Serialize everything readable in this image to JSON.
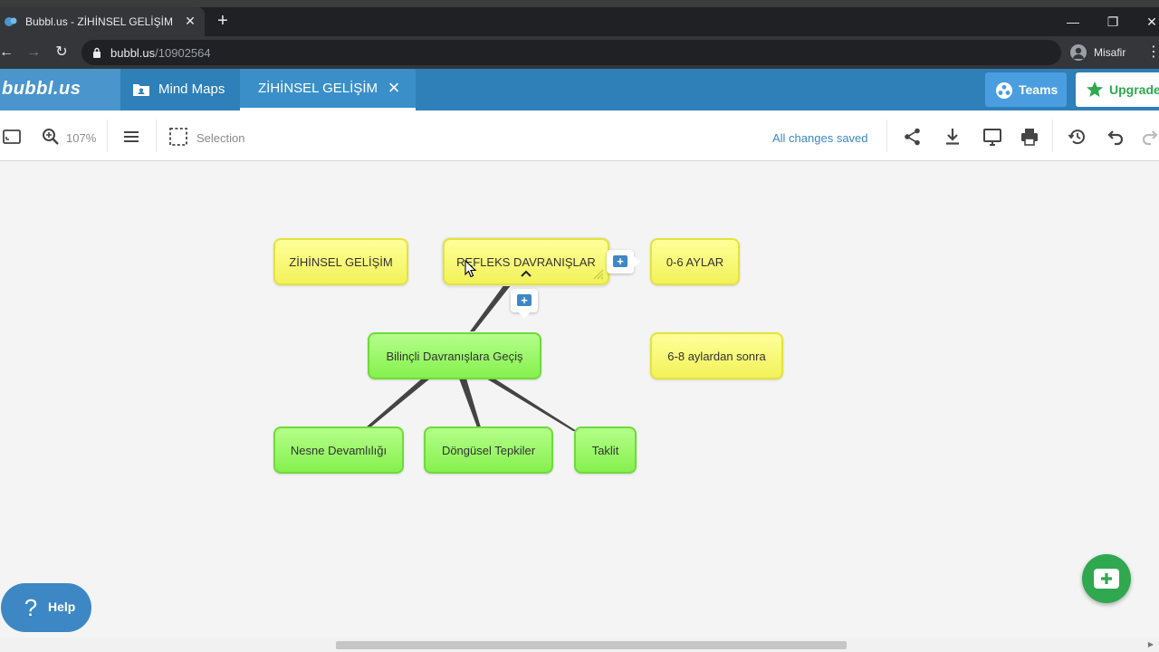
{
  "browser": {
    "tab_title": "Bubbl.us - ZİHİNSEL GELİŞİM",
    "url_host": "bubbl.us",
    "url_path": "/10902564",
    "profile_name": "Misafir"
  },
  "header": {
    "logo": "bubbl.us",
    "nav_mindmaps": "Mind Maps",
    "doc_tab": "ZİHİNSEL GELİŞİM",
    "teams_label": "Teams",
    "upgrade_label": "Upgrade"
  },
  "toolbar": {
    "zoom": "107%",
    "selection_label": "Selection",
    "save_status": "All changes saved"
  },
  "mindmap": {
    "nodes": [
      {
        "id": "n1",
        "label": "ZİHİNSEL GELİŞİM",
        "color": "yellow"
      },
      {
        "id": "n2",
        "label": "REFLEKS DAVRANIŞLAR",
        "color": "yellow",
        "selected": true
      },
      {
        "id": "n3",
        "label": "0-6 AYLAR",
        "color": "yellow"
      },
      {
        "id": "n4",
        "label": "Bilinçli Davranışlara Geçiş",
        "color": "green"
      },
      {
        "id": "n5",
        "label": "6-8 aylardan sonra",
        "color": "yellow"
      },
      {
        "id": "n6",
        "label": "Nesne Devamlılığı",
        "color": "green"
      },
      {
        "id": "n7",
        "label": "Döngüsel Tepkiler",
        "color": "green"
      },
      {
        "id": "n8",
        "label": "Taklit",
        "color": "green"
      }
    ],
    "connections": [
      [
        "n2",
        "n4"
      ],
      [
        "n4",
        "n6"
      ],
      [
        "n4",
        "n7"
      ],
      [
        "n4",
        "n8"
      ]
    ]
  },
  "help": {
    "label": "Help"
  },
  "colors": {
    "header_blue": "#2f7fb8",
    "accent_blue": "#3d88c4",
    "upgrade_green": "#2fa84f",
    "node_yellow": "#f2f25a",
    "node_green": "#86f04e"
  }
}
